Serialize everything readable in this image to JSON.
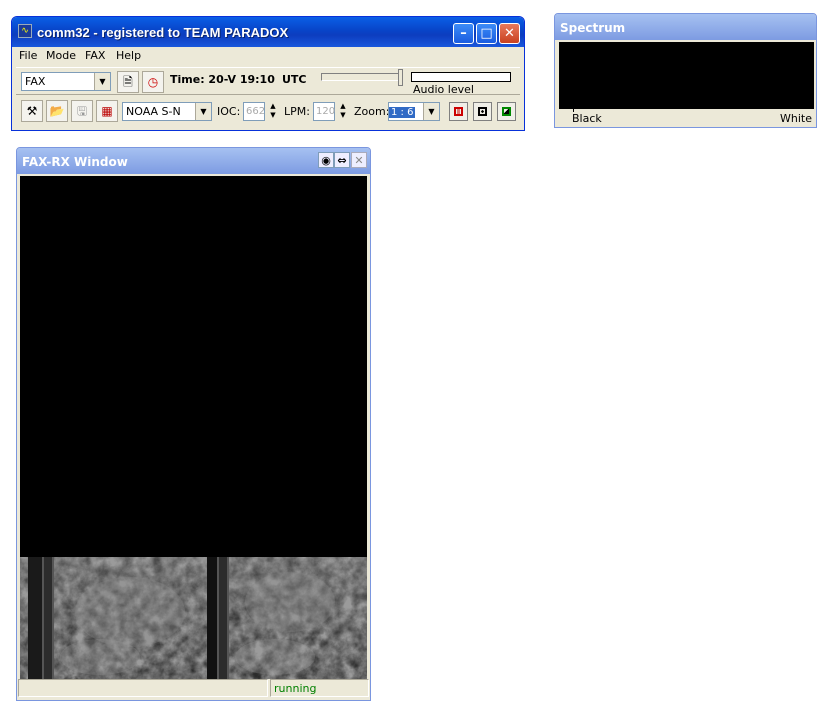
{
  "main_window": {
    "title": "comm32 - registered to TEAM PARADOX",
    "menu": [
      "File",
      "Mode",
      "FAX",
      "Help"
    ],
    "mode_select": "FAX",
    "time_label": "Time: 20-V 19:10",
    "utc_label": "UTC",
    "audio_level_label": "Audio level",
    "station_select": "NOAA S-N",
    "ioc_label": "IOC:",
    "ioc_value": "662",
    "lpm_label": "LPM:",
    "lpm_value": "120",
    "zoom_label": "Zoom:",
    "zoom_value": "1 : 6"
  },
  "spectrum_window": {
    "title": "Spectrum",
    "left_label": "Black",
    "right_label": "White"
  },
  "fax_window": {
    "title": "FAX-RX Window",
    "status": "running"
  },
  "colors": {
    "titlebar_blue": "#0a5fe6",
    "toolwindow_blue": "#7d9be2",
    "status_green": "#008000"
  }
}
